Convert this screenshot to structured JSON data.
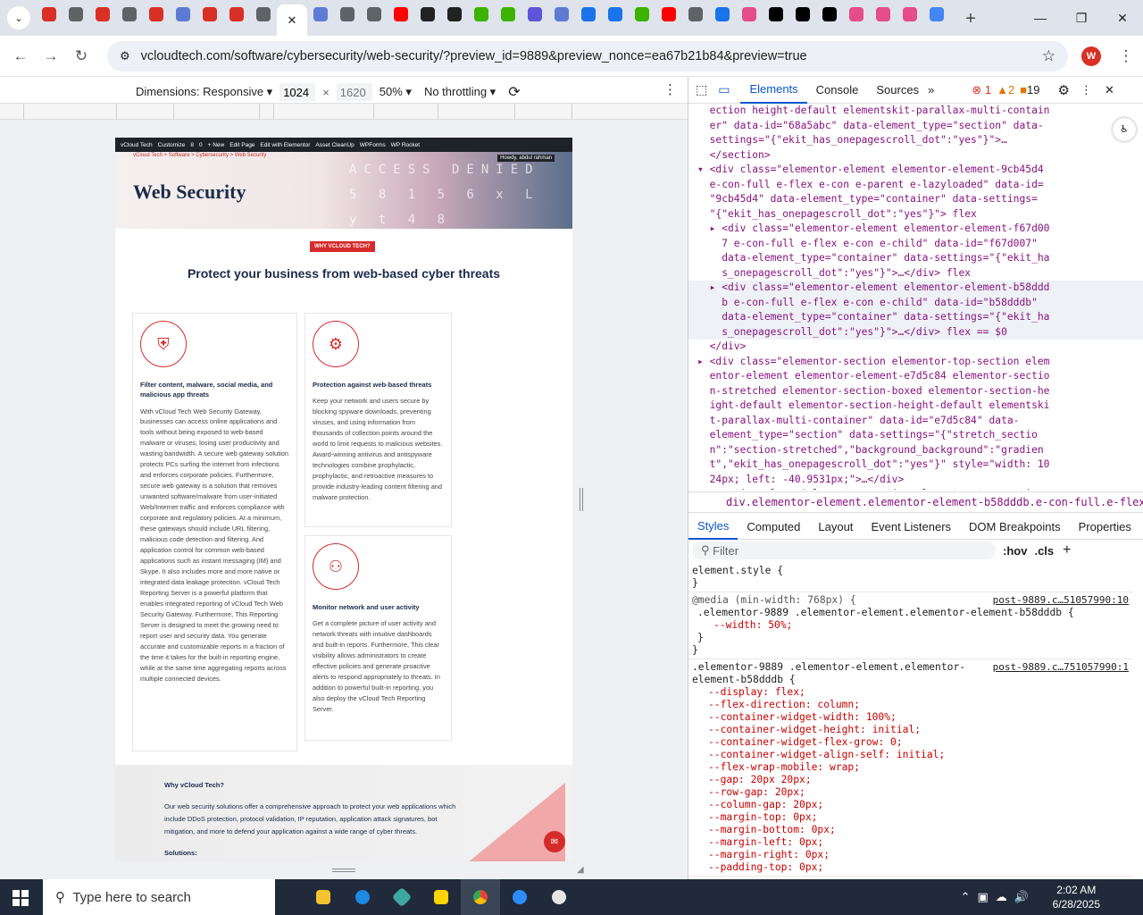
{
  "browser": {
    "url": "vcloudtech.com/software/cybersecurity/web-security/?preview_id=9889&preview_nonce=ea67b21b84&preview=true",
    "profile_initial": "W",
    "tab_colors": [
      "#d93025",
      "#5f6368",
      "#d93025",
      "#5f6368",
      "#d93025",
      "#5e7bd4",
      "#d93025",
      "#d93025",
      "#5f6368",
      "#ffffff",
      "#5e7bd4",
      "#5f6368",
      "#5f6368",
      "#ff0000",
      "#222222",
      "#222222",
      "#3cb300",
      "#3cb300",
      "#5e55d9",
      "#5e7bd4",
      "#1a73e8",
      "#1a73e8",
      "#3cb300",
      "#ff0000",
      "#5f6368",
      "#1a73e8",
      "#e44d8a",
      "#000000",
      "#000000",
      "#000000",
      "#e44d8a",
      "#e44d8a",
      "#e44d8a",
      "#4285f4"
    ]
  },
  "devbar": {
    "dimensions_label": "Dimensions: Responsive ▾",
    "width": "1024",
    "times": "×",
    "height_placeholder": "1620",
    "zoom": "50% ▾",
    "throttle": "No throttling ▾"
  },
  "site": {
    "wpbar_items": [
      "vCloud Tech",
      "Customize",
      "8",
      "0",
      "+ New",
      "Edit Page",
      "Edit with Elementor",
      "Asset CleanUp",
      "WPForms",
      "WP Rocket"
    ],
    "breadcrumb": "vCloud Tech > Software > Cybersecurity > Web Security",
    "howdy": "Howdy, abdul rahman",
    "hero_deco": "ACCESS DENIED  5 8 1 5 6  x  L  y  t 4 8",
    "title": "Web Security",
    "badge": "WHY VCLOUD TECH?",
    "headline": "Protect your business from web-based cyber threats",
    "cards": [
      {
        "title": "Filter content, malware, social media, and malicious app threats",
        "body": "With vCloud Tech Web Security Gateway, businesses can access online applications and tools without being exposed to web-based malware or viruses, losing user productivity and wasting bandwidth. A secure web gateway solution protects PCs surfing the internet from infections and enforces corporate policies. Furthermore, secure web gateway is a solution that removes unwanted software/malware from user-initiated Web/Internet traffic and enforces compliance with corporate and regulatory policies. At a minimum, these gateways should include URL filtering, malicious code detection and filtering. And application control for common web-based applications such as instant messaging (IM) and Skype. It also includes more and more native or integrated data leakage protection. vCloud Tech Reporting Server is a powerful platform that enables integrated reporting of vCloud Tech Web Security Gateway. Furthermore, This Reporting Server is designed to meet the growing need to report user and security data. You generate accurate and customizable reports in a fraction of the time it takes for the built-in reporting engine, while at the same time aggregating reports across multiple connected devices."
      },
      {
        "title": "Protection against web-based threats",
        "body": "Keep your network and users secure by blocking spyware downloads, preventing viruses, and using information from thousands of collection points around the world to limit requests to malicious websites. Award-winning antivirus and antispyware technologies combine prophylactic, prophylactic, and retroactive measures to provide industry-leading content filtering and malware protection."
      },
      {
        "title": "Monitor network and user activity",
        "body": "Get a complete picture of user activity and network threats with intuitive dashboards and built-in reports. Furthermore, This clear visibility allows administrators to create effective policies and generate proactive alerts to respond appropriately to threats. In addition to powerful built-in reporting, you also deploy the vCloud Tech Reporting Server."
      }
    ],
    "why_title": "Why vCloud Tech?",
    "why_body": "Our web security solutions offer a comprehensive approach to protect your web applications which include DDoS protection, protocol validation, IP reputation, application attack signatures, bot mitigation, and more to defend your application against a wide range of cyber threats.",
    "solutions": "Solutions:"
  },
  "devtools": {
    "tabs": [
      "Elements",
      "Console",
      "Sources"
    ],
    "errors": "1",
    "warnings": "2",
    "issues": "19",
    "breadcrumb": "div.elementor-element.elementor-element-b58dddb.e-con-full.e-flex.e-con.e-child",
    "style_tabs": [
      "Styles",
      "Computed",
      "Layout",
      "Event Listeners",
      "DOM Breakpoints",
      "Properties"
    ],
    "filter_placeholder": "Filter",
    "hov": ":hov",
    "cls": ".cls",
    "dom_lines": [
      "  ection height-default elementskit-parallax-multi-contain",
      "  er\" data-id=\"68a5abc\" data-element_type=\"section\" data-",
      "  settings=\"{\"ekit_has_onepagescroll_dot\":\"yes\"}\">…",
      "  </section>",
      "▾ <div class=\"elementor-element elementor-element-9cb45d4",
      "  e-con-full e-flex e-con e-parent e-lazyloaded\" data-id=",
      "  \"9cb45d4\" data-element_type=\"container\" data-settings=",
      "  \"{\"ekit_has_onepagescroll_dot\":\"yes\"}\"> flex",
      "  ▸ <div class=\"elementor-element elementor-element-f67d00",
      "    7 e-con-full e-flex e-con e-child\" data-id=\"f67d007\"",
      "    data-element_type=\"container\" data-settings=\"{\"ekit_ha",
      "    s_onepagescroll_dot\":\"yes\"}\">…</div> flex",
      "  ▸ <div class=\"elementor-element elementor-element-b58ddd",
      "    b e-con-full e-flex e-con e-child\" data-id=\"b58dddb\"",
      "    data-element_type=\"container\" data-settings=\"{\"ekit_ha",
      "    s_onepagescroll_dot\":\"yes\"}\">…</div> flex == $0",
      "  </div>",
      "▸ <div class=\"elementor-section elementor-top-section elem",
      "  entor-element elementor-element-e7d5c84 elementor-sectio",
      "  n-stretched elementor-section-boxed elementor-section-he",
      "  ight-default elementor-section-height-default elementski",
      "  t-parallax-multi-container\" data-id=\"e7d5c84\" data-",
      "  element_type=\"section\" data-settings=\"{\"stretch_sectio",
      "  n\":\"section-stretched\",\"background_background\":\"gradien",
      "  t\",\"ekit_has_onepagescroll_dot\":\"yes\"}\" style=\"width: 10",
      "  24px; left: -40.9531px;\">…</div>",
      "▸ <section class=\"elementor-section elementor-top-section"
    ],
    "rule1_selector": "element.style {",
    "rule1_end": "}",
    "rule2_media": "@media (min-width: 768px) {",
    "rule2_src": "post-9889.c…51057990:10",
    "rule2_selector": ".elementor-9889 .elementor-element.elementor-element-b58dddb {",
    "rule2_prop": "--width: 50%;",
    "rule3_src": "post-9889.c…751057990:1",
    "rule3_selector": ".elementor-9889 .elementor-element.elementor-element-b58dddb {",
    "rule3_props": [
      "--display: flex;",
      "--flex-direction: column;",
      "--container-widget-width: 100%;",
      "--container-widget-height: initial;",
      "--container-widget-flex-grow: 0;",
      "--container-widget-align-self: initial;",
      "--flex-wrap-mobile: wrap;",
      "--gap: 20px 20px;",
      "--row-gap: 20px;",
      "--column-gap: 20px;",
      "--margin-top: 0px;",
      "--margin-bottom: 0px;",
      "--margin-left: 0px;",
      "--margin-right: 0px;",
      "--padding-top: 0px;"
    ]
  },
  "taskbar": {
    "search_placeholder": "Type here to search",
    "time": "2:02 AM",
    "date": "6/28/2025"
  }
}
